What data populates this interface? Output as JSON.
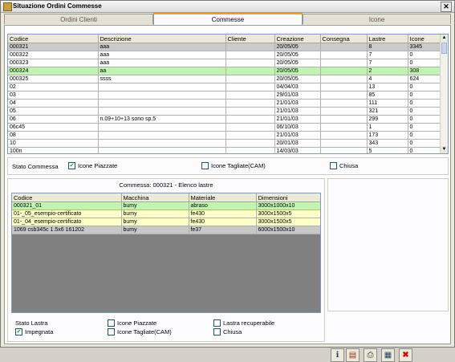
{
  "window": {
    "title": "Situazione Ordini Commesse",
    "close_glyph": "✕"
  },
  "tabs": [
    {
      "label": "Ordini Clienti"
    },
    {
      "label": "Commesse"
    },
    {
      "label": "Icone"
    }
  ],
  "commesse_table": {
    "headers": [
      "Codice",
      "Descrizione",
      "Cliente",
      "Creazione",
      "Consegna",
      "Lastre",
      "Icone"
    ],
    "rows": [
      [
        "000321",
        "aaa",
        "",
        "20/05/05",
        "",
        "8",
        "3345"
      ],
      [
        "000322",
        "aaa",
        "",
        "20/05/05",
        "",
        "7",
        "0"
      ],
      [
        "000323",
        "aaa",
        "",
        "20/05/05",
        "",
        "7",
        "0"
      ],
      [
        "000324",
        "aa",
        "",
        "20/05/05",
        "",
        "2",
        "308"
      ],
      [
        "000325",
        "ssss",
        "",
        "20/05/05",
        "",
        "4",
        "624"
      ],
      [
        "02",
        "",
        "",
        "04/04/03",
        "",
        "13",
        "0"
      ],
      [
        "03",
        "",
        "",
        "29/01/03",
        "",
        "85",
        "0"
      ],
      [
        "04",
        "",
        "",
        "21/01/03",
        "",
        "111",
        "0"
      ],
      [
        "05",
        "",
        "",
        "21/01/03",
        "",
        "321",
        "0"
      ],
      [
        "06",
        "n.09+10+13 sono sp.5",
        "",
        "21/01/03",
        "",
        "299",
        "0"
      ],
      [
        "06c45",
        "",
        "",
        "06/10/03",
        "",
        "1",
        "0"
      ],
      [
        "08",
        "",
        "",
        "21/01/03",
        "",
        "173",
        "0"
      ],
      [
        "10",
        "",
        "",
        "20/01/03",
        "",
        "343",
        "0"
      ],
      [
        "100n",
        "",
        "",
        "14/03/03",
        "",
        "5",
        "0"
      ]
    ]
  },
  "stato_commessa": {
    "label": "Stato Commessa",
    "options": [
      {
        "label": "Icone Piazzate",
        "checked": true
      },
      {
        "label": "Icone Tagliate(CAM)",
        "checked": false
      },
      {
        "label": "Chiusa",
        "checked": false
      }
    ]
  },
  "lastre_section": {
    "title": "Commessa: 000321 - Elenco lastre",
    "headers": [
      "Codice",
      "Macchina",
      "Materiale",
      "Dimensioni"
    ],
    "rows": [
      [
        "000321_01",
        "bumy",
        "abraso",
        "3000x1000x10"
      ],
      [
        "01-_05_esempio-certificato",
        "bumy",
        "fe430",
        "3000x1500x5"
      ],
      [
        "01-_04_esempio-certificato",
        "bumy",
        "fe430",
        "3000x1500x5"
      ],
      [
        "1069 csb345c 1.5x6 161202",
        "bumy",
        "fe37",
        "6000x1500x10"
      ]
    ]
  },
  "stato_lastra": {
    "label": "Stato Lastra",
    "options": [
      {
        "label": "Impegnata",
        "checked": true
      },
      {
        "label": "Icone Piazzate",
        "checked": false
      },
      {
        "label": "Icone Tagliate(CAM)",
        "checked": false
      },
      {
        "label": "Lastra recuperabile",
        "checked": false
      },
      {
        "label": "Chiusa",
        "checked": false
      }
    ]
  },
  "toolbar": {
    "buttons": [
      {
        "icon": "info-document-icon",
        "glyph": "ℹ"
      },
      {
        "icon": "print-list-icon",
        "glyph": "▤"
      },
      {
        "icon": "printer-icon",
        "glyph": "⎙"
      },
      {
        "icon": "export-icon",
        "glyph": "▦"
      },
      {
        "icon": "delete-icon",
        "glyph": "✖"
      }
    ]
  },
  "colors": {
    "selected_row": "#cbcbcb",
    "highlight_row": "#c0f4b0",
    "yellow_row": "#fefec8",
    "grey_row": "#c8c8c8",
    "delete_red": "#d01010"
  }
}
